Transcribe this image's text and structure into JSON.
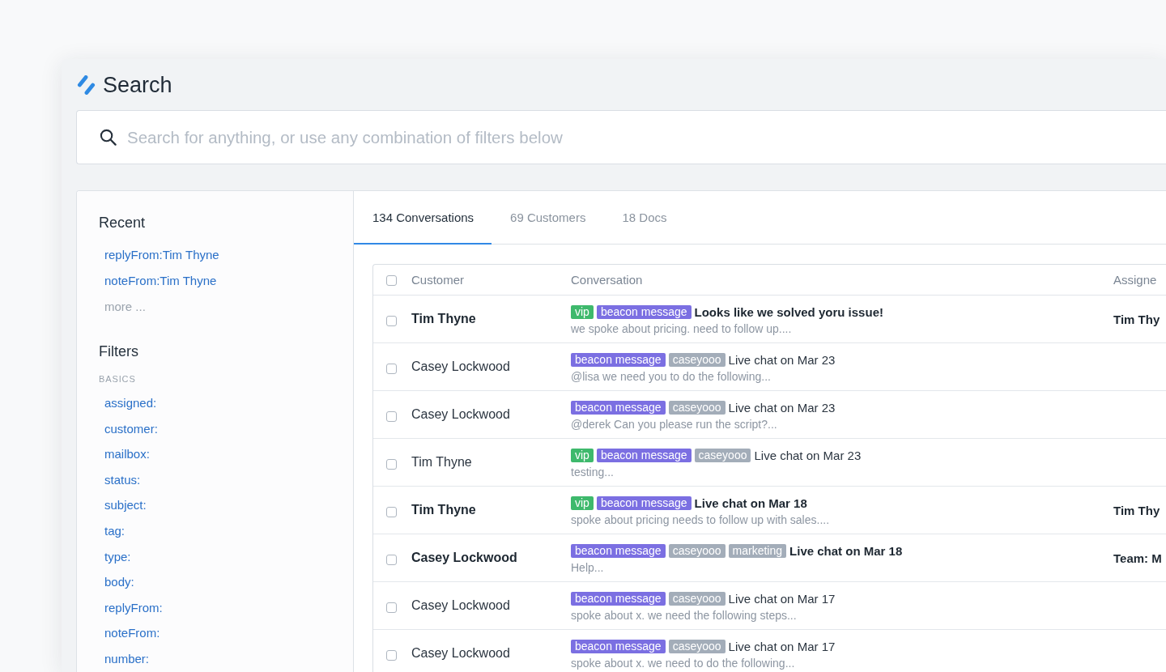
{
  "window": {
    "title": "Search"
  },
  "search": {
    "placeholder": "Search for anything, or use any combination of filters below"
  },
  "sidebar": {
    "recent": {
      "title": "Recent",
      "items": [
        "replyFrom:Tim Thyne",
        "noteFrom:Tim Thyne"
      ],
      "more": "more ..."
    },
    "filters": {
      "title": "Filters",
      "sections": [
        {
          "heading": "BASICS",
          "items": [
            "assigned:",
            "customer:",
            "mailbox:",
            "status:",
            "subject:",
            "tag:",
            "type:",
            "body:",
            "replyFrom:",
            "noteFrom:",
            "number:"
          ]
        }
      ]
    }
  },
  "tabs": [
    {
      "label": "134 Conversations",
      "selected": true
    },
    {
      "label": "69 Customers",
      "selected": false
    },
    {
      "label": "18 Docs",
      "selected": false
    }
  ],
  "table": {
    "select_all": {
      "checked": false
    },
    "columns": [
      "Customer",
      "Conversation",
      "Assigne"
    ],
    "rows": [
      {
        "checked": false,
        "unread": true,
        "customer": "Tim Thyne",
        "tags": [
          {
            "label": "vip",
            "color": "#3eb96c"
          },
          {
            "label": "beacon message",
            "color": "#7b6fe2"
          }
        ],
        "subject": "Looks like we solved yoru issue!",
        "preview": "we spoke about pricing. need to follow up....",
        "assignee": "Tim Thy"
      },
      {
        "checked": false,
        "unread": false,
        "customer": "Casey Lockwood",
        "tags": [
          {
            "label": "beacon message",
            "color": "#7b6fe2"
          },
          {
            "label": "caseyooo",
            "color": "#a3adb9"
          }
        ],
        "subject": "Live chat on Mar 23",
        "preview": "@lisa we need you to do the following..."
      },
      {
        "checked": false,
        "unread": false,
        "customer": "Casey Lockwood",
        "tags": [
          {
            "label": "beacon message",
            "color": "#7b6fe2"
          },
          {
            "label": "caseyooo",
            "color": "#a3adb9"
          }
        ],
        "subject": "Live chat on Mar 23",
        "preview": "@derek Can you please run the script?..."
      },
      {
        "checked": false,
        "unread": false,
        "customer": "Tim Thyne",
        "tags": [
          {
            "label": "vip",
            "color": "#3eb96c"
          },
          {
            "label": "beacon message",
            "color": "#7b6fe2"
          },
          {
            "label": "caseyooo",
            "color": "#a3adb9"
          }
        ],
        "subject": "Live chat on Mar 23",
        "preview": "testing..."
      },
      {
        "checked": false,
        "unread": true,
        "customer": "Tim Thyne",
        "tags": [
          {
            "label": "vip",
            "color": "#3eb96c"
          },
          {
            "label": "beacon message",
            "color": "#7b6fe2"
          }
        ],
        "subject": "Live chat on Mar 18",
        "preview": "spoke about pricing needs to follow up with sales....",
        "assignee": "Tim Thy"
      },
      {
        "checked": false,
        "unread": true,
        "customer": "Casey Lockwood",
        "tags": [
          {
            "label": "beacon message",
            "color": "#7b6fe2"
          },
          {
            "label": "caseyooo",
            "color": "#a3adb9"
          },
          {
            "label": "marketing",
            "color": "#a3adb9"
          }
        ],
        "subject": "Live chat on Mar 18",
        "preview": "Help...",
        "assignee": "Team: M"
      },
      {
        "checked": false,
        "unread": false,
        "customer": "Casey Lockwood",
        "tags": [
          {
            "label": "beacon message",
            "color": "#7b6fe2"
          },
          {
            "label": "caseyooo",
            "color": "#a3adb9"
          }
        ],
        "subject": "Live chat on Mar 17",
        "preview": "spoke about x. we need the following steps..."
      },
      {
        "checked": false,
        "unread": false,
        "customer": "Casey Lockwood",
        "tags": [
          {
            "label": "beacon message",
            "color": "#7b6fe2"
          },
          {
            "label": "caseyooo",
            "color": "#a3adb9"
          }
        ],
        "subject": "Live chat on Mar 17",
        "preview": "spoke about x. we need to do the following..."
      }
    ]
  }
}
